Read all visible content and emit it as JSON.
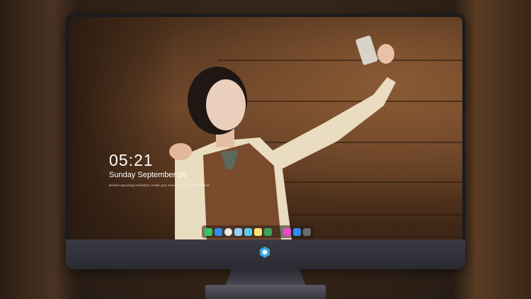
{
  "lockscreen": {
    "time": "05:21",
    "date": "Sunday September  28",
    "note": "Review upcoming reminders, create your event, simply click 'Reflection'"
  },
  "dock": {
    "icons": [
      "messages-icon",
      "finder-icon",
      "safari-icon",
      "preview-icon",
      "finder-face-icon",
      "notes-icon",
      "facetime-icon",
      "itunes-icon",
      "app-store-icon",
      "camera-icon"
    ]
  },
  "colors": {
    "background": "#3d2a1c",
    "monitor_bezel": "#1b1b1f",
    "chin": "#34343d"
  }
}
